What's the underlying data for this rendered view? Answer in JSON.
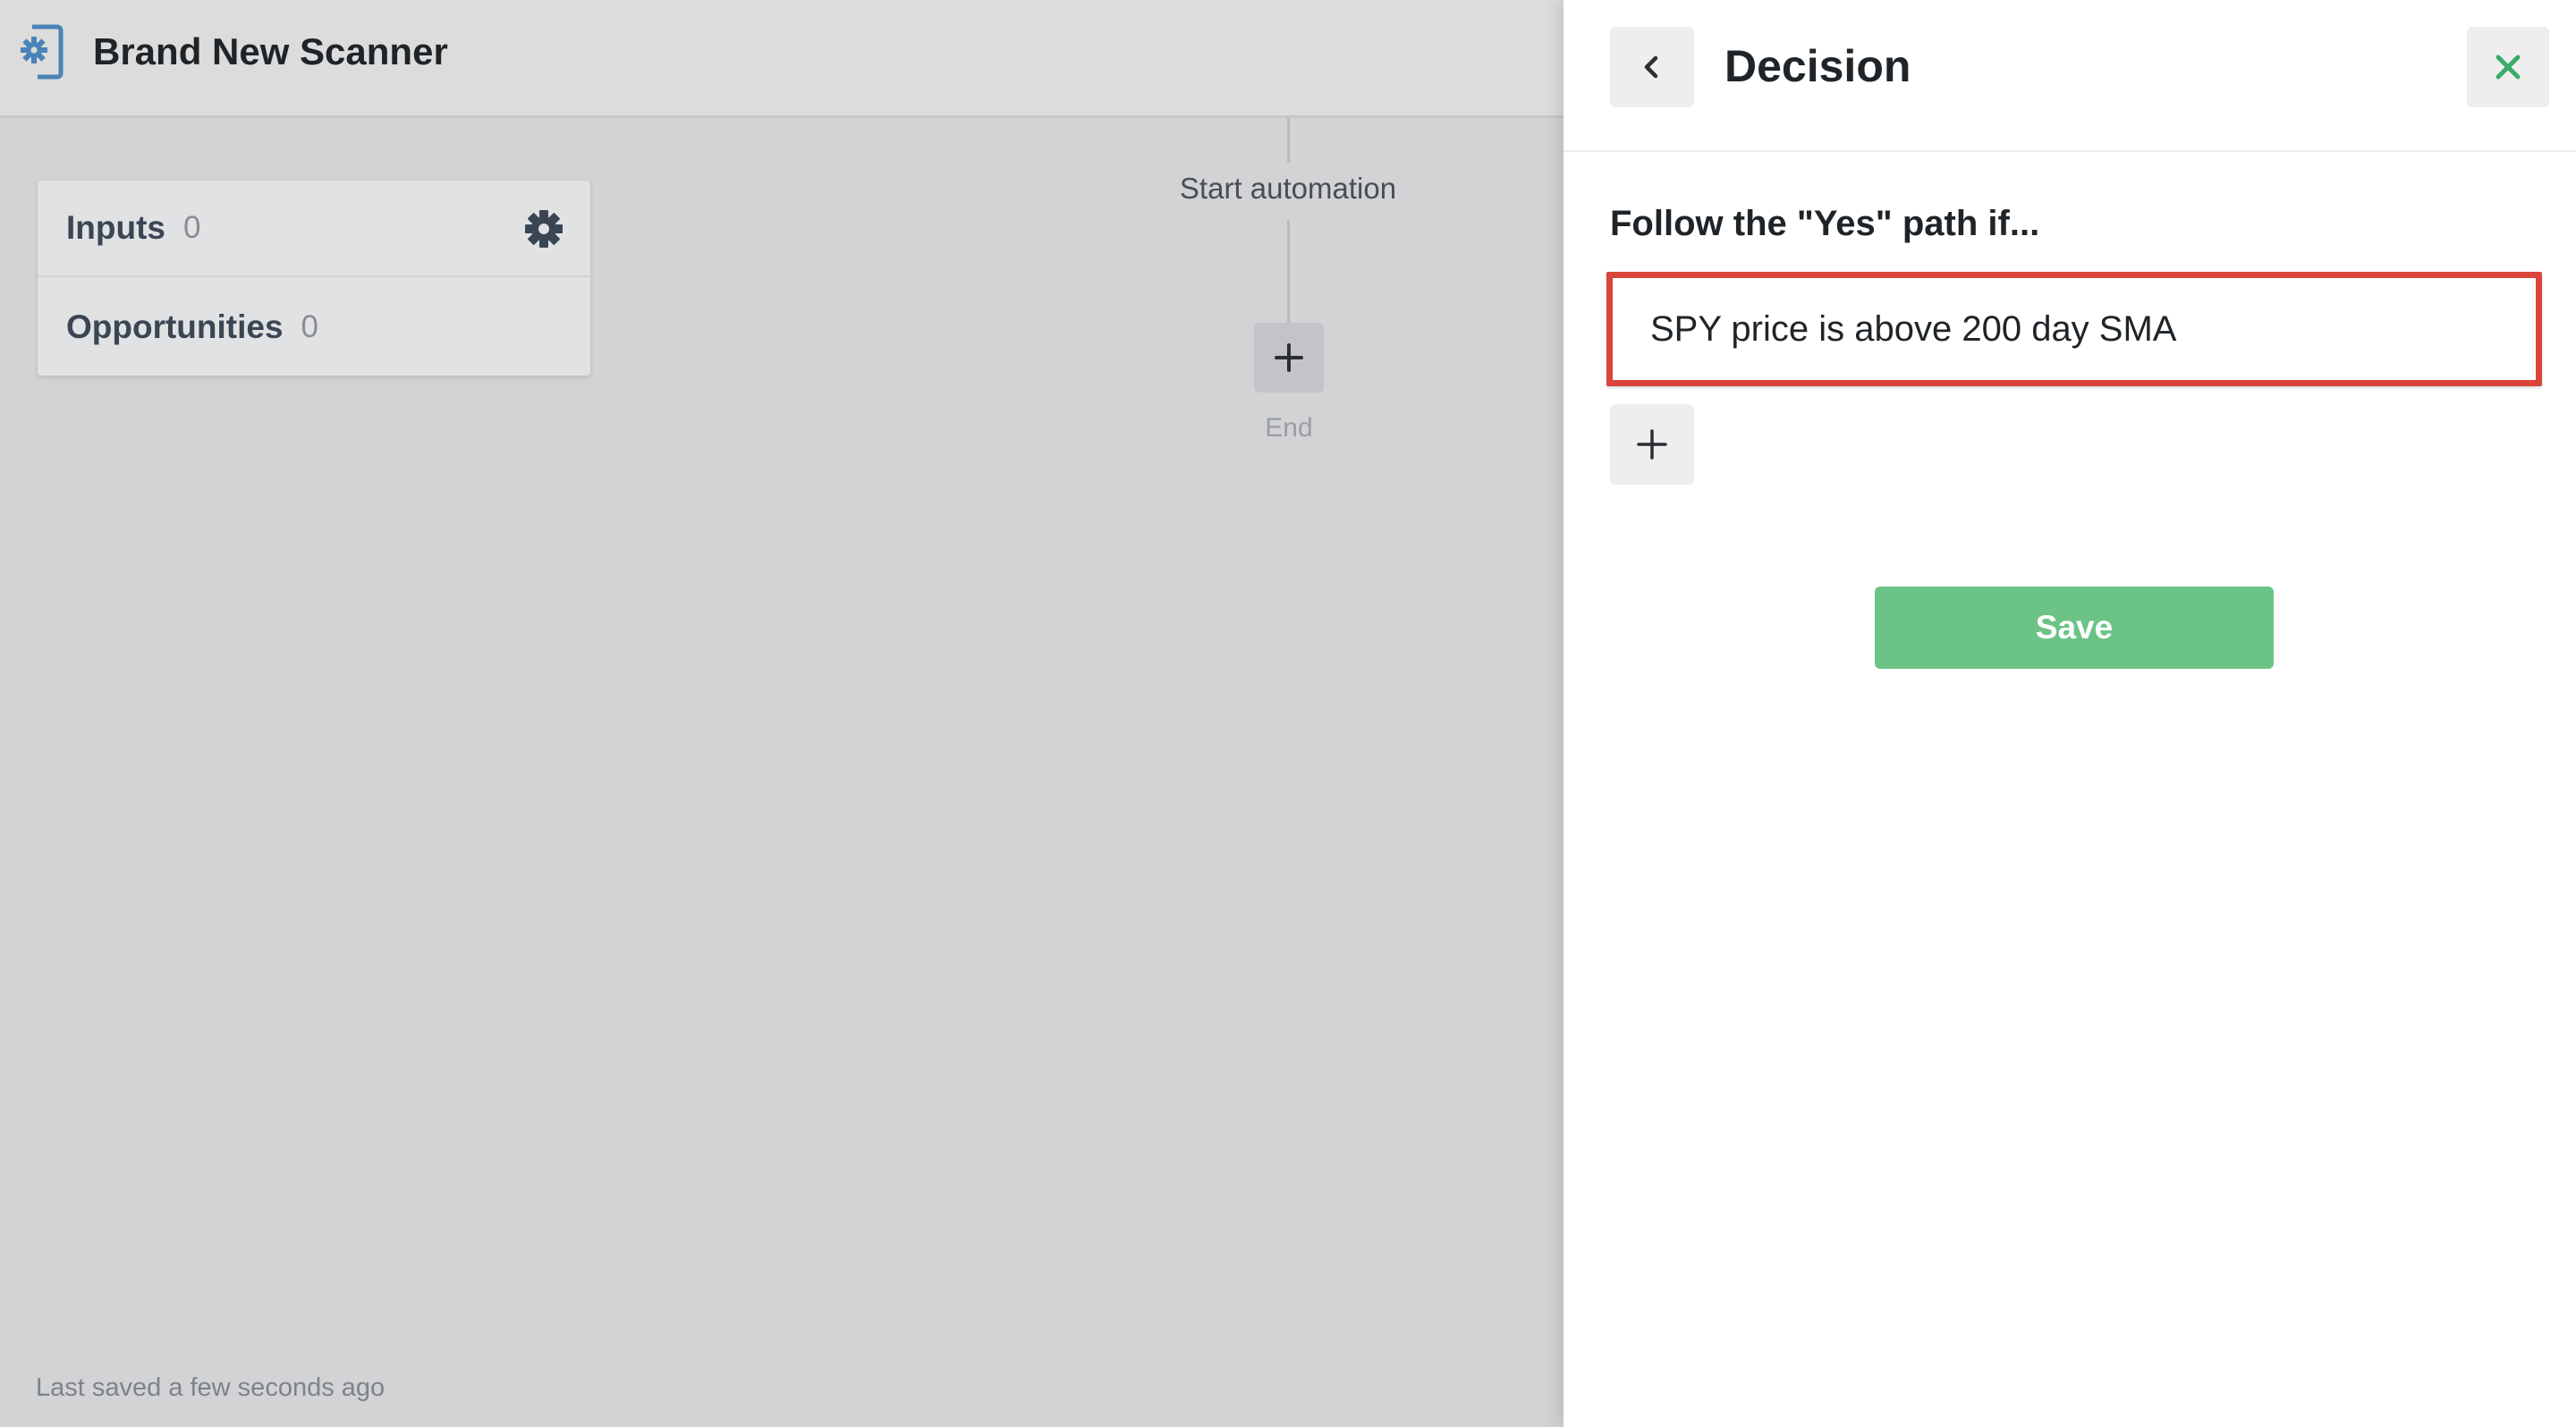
{
  "header": {
    "title": "Brand New Scanner",
    "logo_icon": "scanner-gear-document-icon"
  },
  "sidebar_card": {
    "rows": [
      {
        "label": "Inputs",
        "count": "0"
      },
      {
        "label": "Opportunities",
        "count": "0"
      }
    ],
    "settings_icon": "gear-icon"
  },
  "flow": {
    "start_label": "Start automation",
    "end_label": "End",
    "add_icon": "plus-icon"
  },
  "status": {
    "saved_text": "Last saved a few seconds ago"
  },
  "panel": {
    "title": "Decision",
    "back_icon": "chevron-left-icon",
    "close_icon": "close-icon",
    "condition_heading": "Follow the \"Yes\" path if...",
    "condition_value": "SPY price is above 200 day SMA",
    "add_condition_icon": "plus-icon",
    "save_label": "Save"
  },
  "colors": {
    "accent_green": "#6cc386",
    "close_green": "#3bab6a",
    "highlight_red": "#d9453b",
    "logo_blue": "#4a83b8"
  }
}
